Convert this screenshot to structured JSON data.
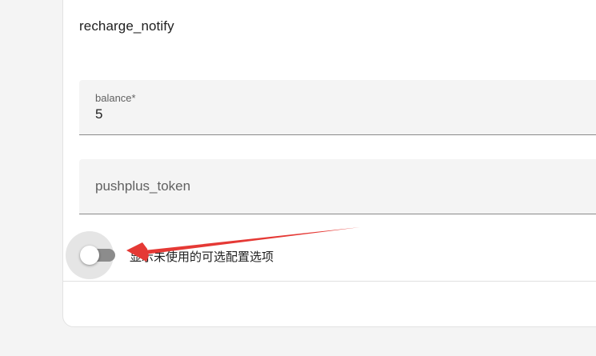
{
  "card": {
    "title": "recharge_notify"
  },
  "fields": {
    "balance": {
      "label": "balance*",
      "value": "5"
    },
    "pushplus_token": {
      "placeholder": "pushplus_token",
      "value": ""
    }
  },
  "toggle": {
    "label": "显示未使用的可选配置选项",
    "state": "off"
  },
  "colors": {
    "arrow": "#e53935",
    "field_bg": "#f4f4f4",
    "track_off": "#8c8c8c"
  }
}
